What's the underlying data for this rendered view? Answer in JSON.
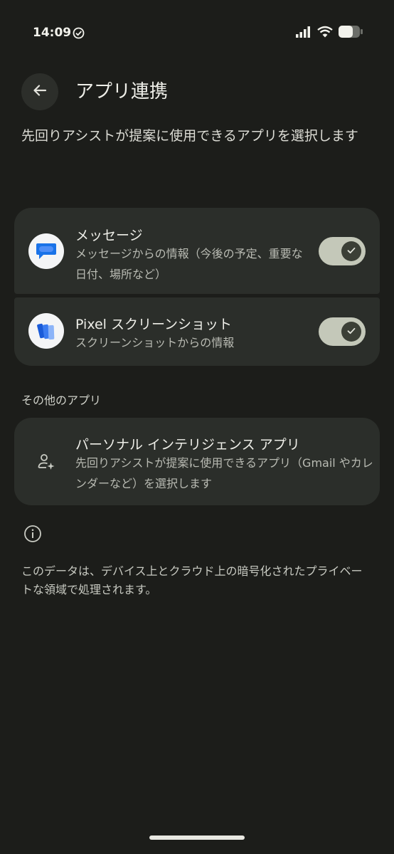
{
  "status_bar": {
    "time": "14:09"
  },
  "header": {
    "title": "アプリ連携",
    "subtitle": "先回りアシストが提案に使用できるアプリを選択します"
  },
  "apps": [
    {
      "title": "メッセージ",
      "description": "メッセージからの情報（今後の予定、重要な日付、場所など）",
      "enabled": true,
      "icon": "messages-app-icon"
    },
    {
      "title": "Pixel スクリーンショット",
      "description": "スクリーンショットからの情報",
      "enabled": true,
      "icon": "pixel-screenshots-app-icon"
    }
  ],
  "other_apps": {
    "section_title": "その他のアプリ",
    "item": {
      "title": "パーソナル インテリジェンス アプリ",
      "description": "先回りアシストが提案に使用できるアプリ（Gmail やカレンダーなど）を選択します",
      "icon": "person-sparkle-icon"
    }
  },
  "footer": {
    "note": "このデータは、デバイス上とクラウド上の暗号化されたプライベートな領域で処理されます。",
    "icon": "info-icon"
  },
  "colors": {
    "background": "#1c1d1a",
    "card": "#2b2e2a",
    "toggle_on": "#c4c8b9"
  }
}
